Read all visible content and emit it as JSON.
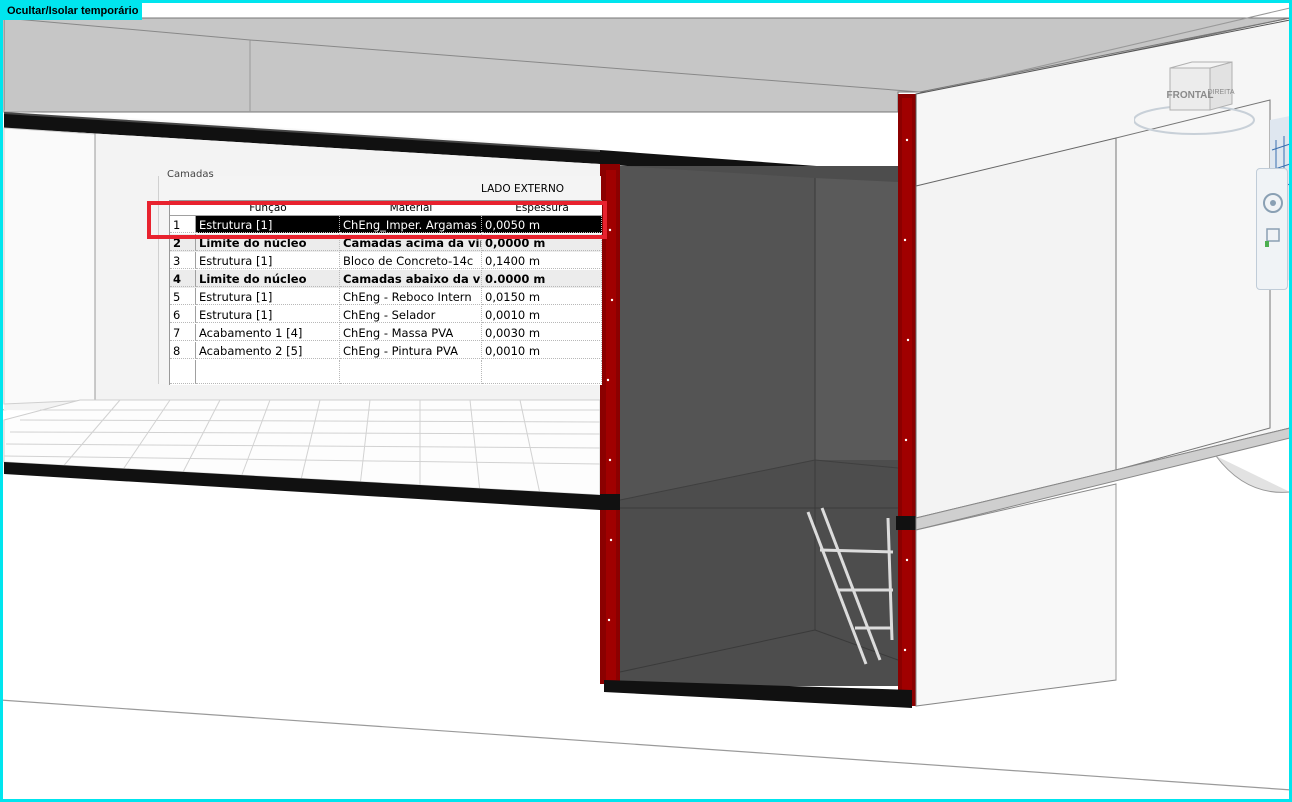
{
  "viewport": {
    "mode_label": "Ocultar/Isolar temporário",
    "frame_color": "#00e5ee"
  },
  "viewcube": {
    "face_label": "FRONTAL",
    "side_label": "DIREITA"
  },
  "layers_panel": {
    "caption": "Camadas",
    "side_label": "LADO EXTERNO",
    "columns": [
      "Função",
      "Material",
      "Espessura"
    ],
    "rows": [
      {
        "num": "1",
        "function": "Estrutura [1]",
        "material": "ChEng_Imper. Argamas",
        "thickness": "0,0050 m",
        "selected": true
      },
      {
        "num": "2",
        "function": "Limite do núcleo",
        "material": "Camadas acima da virada",
        "thickness": "0,0000 m",
        "bold": true
      },
      {
        "num": "3",
        "function": "Estrutura [1]",
        "material": "Bloco de Concreto-14c",
        "thickness": "0,1400 m"
      },
      {
        "num": "4",
        "function": "Limite do núcleo",
        "material": "Camadas abaixo da virad",
        "thickness": "0.0000 m",
        "bold": true
      },
      {
        "num": "5",
        "function": "Estrutura [1]",
        "material": "ChEng - Reboco Intern",
        "thickness": "0,0150 m"
      },
      {
        "num": "6",
        "function": "Estrutura [1]",
        "material": "ChEng - Selador",
        "thickness": "0,0010 m"
      },
      {
        "num": "7",
        "function": "Acabamento 1 [4]",
        "material": "ChEng - Massa PVA",
        "thickness": "0,0030 m"
      },
      {
        "num": "8",
        "function": "Acabamento 2 [5]",
        "material": "ChEng - Pintura PVA",
        "thickness": "0,0010 m"
      }
    ]
  },
  "colors": {
    "highlight": "#e8222e",
    "membrane": "#8b0000",
    "pit_interior": "#4d4d4d",
    "slab_top": "#c6c6c6"
  }
}
